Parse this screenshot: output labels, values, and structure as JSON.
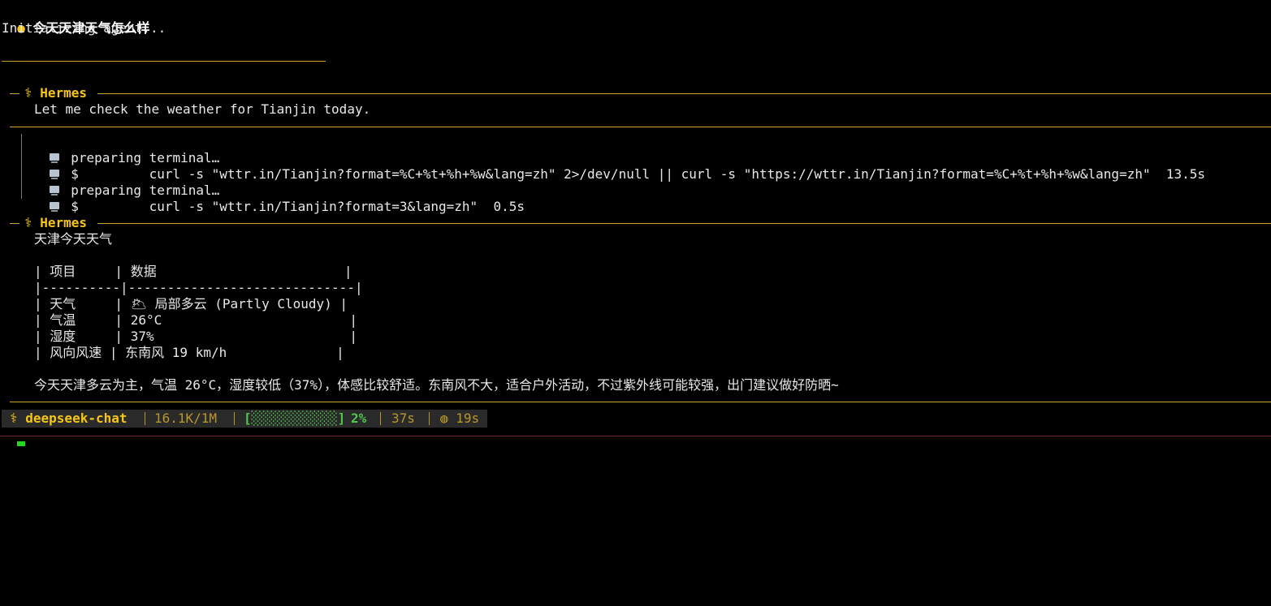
{
  "prompt": {
    "bullet": "●",
    "text": "今天天津天气怎么样"
  },
  "init_text": "Initializing agent...",
  "panels": {
    "first": {
      "name": "⚕ Hermes",
      "message": "Let me check the weather for Tianjin today."
    },
    "second": {
      "name": "⚕ Hermes",
      "heading": "天津今天天气",
      "table_lines": [
        "| 项目     | 数据                        |",
        "|----------|-----------------------------|",
        "| 天气     | 🌥 局部多云 (Partly Cloudy) |",
        "| 气温     | 26°C                        |",
        "| 湿度     | 37%                         |",
        "| 风向风速 | 东南风 19 km/h              |"
      ],
      "summary": "今天天津多云为主，气温 26°C，湿度较低（37%），体感比较舒适。东南风不大，适合户外活动，不过紫外线可能较强，出门建议做好防晒~"
    }
  },
  "tool_calls": [
    {
      "icon": "terminal-icon",
      "text": "preparing terminal…"
    },
    {
      "icon": "terminal-icon",
      "text": "$         curl -s \"wttr.in/Tianjin?format=%C+%t+%h+%w&lang=zh\" 2>/dev/null || curl -s \"https://wttr.in/Tianjin?format=%C+%t+%h+%w&lang=zh\"  13.5s"
    },
    {
      "icon": "terminal-icon",
      "text": "preparing terminal…"
    },
    {
      "icon": "terminal-icon",
      "text": "$         curl -s \"wttr.in/Tianjin?format=3&lang=zh\"  0.5s"
    }
  ],
  "status_bar": {
    "model": "⚕ deepseek-chat",
    "tokens": "16.1K/1M",
    "progress_bar": "[░░░░░░░░░░░]",
    "progress_percent": "2%",
    "progress_value": 0.02,
    "elapsed": "37s",
    "timer": "◍ 19s"
  },
  "colors": {
    "accent_gold": "#f5c518",
    "rule_gold": "#c9a227",
    "status_green": "#4ec94e",
    "background": "#000000"
  }
}
